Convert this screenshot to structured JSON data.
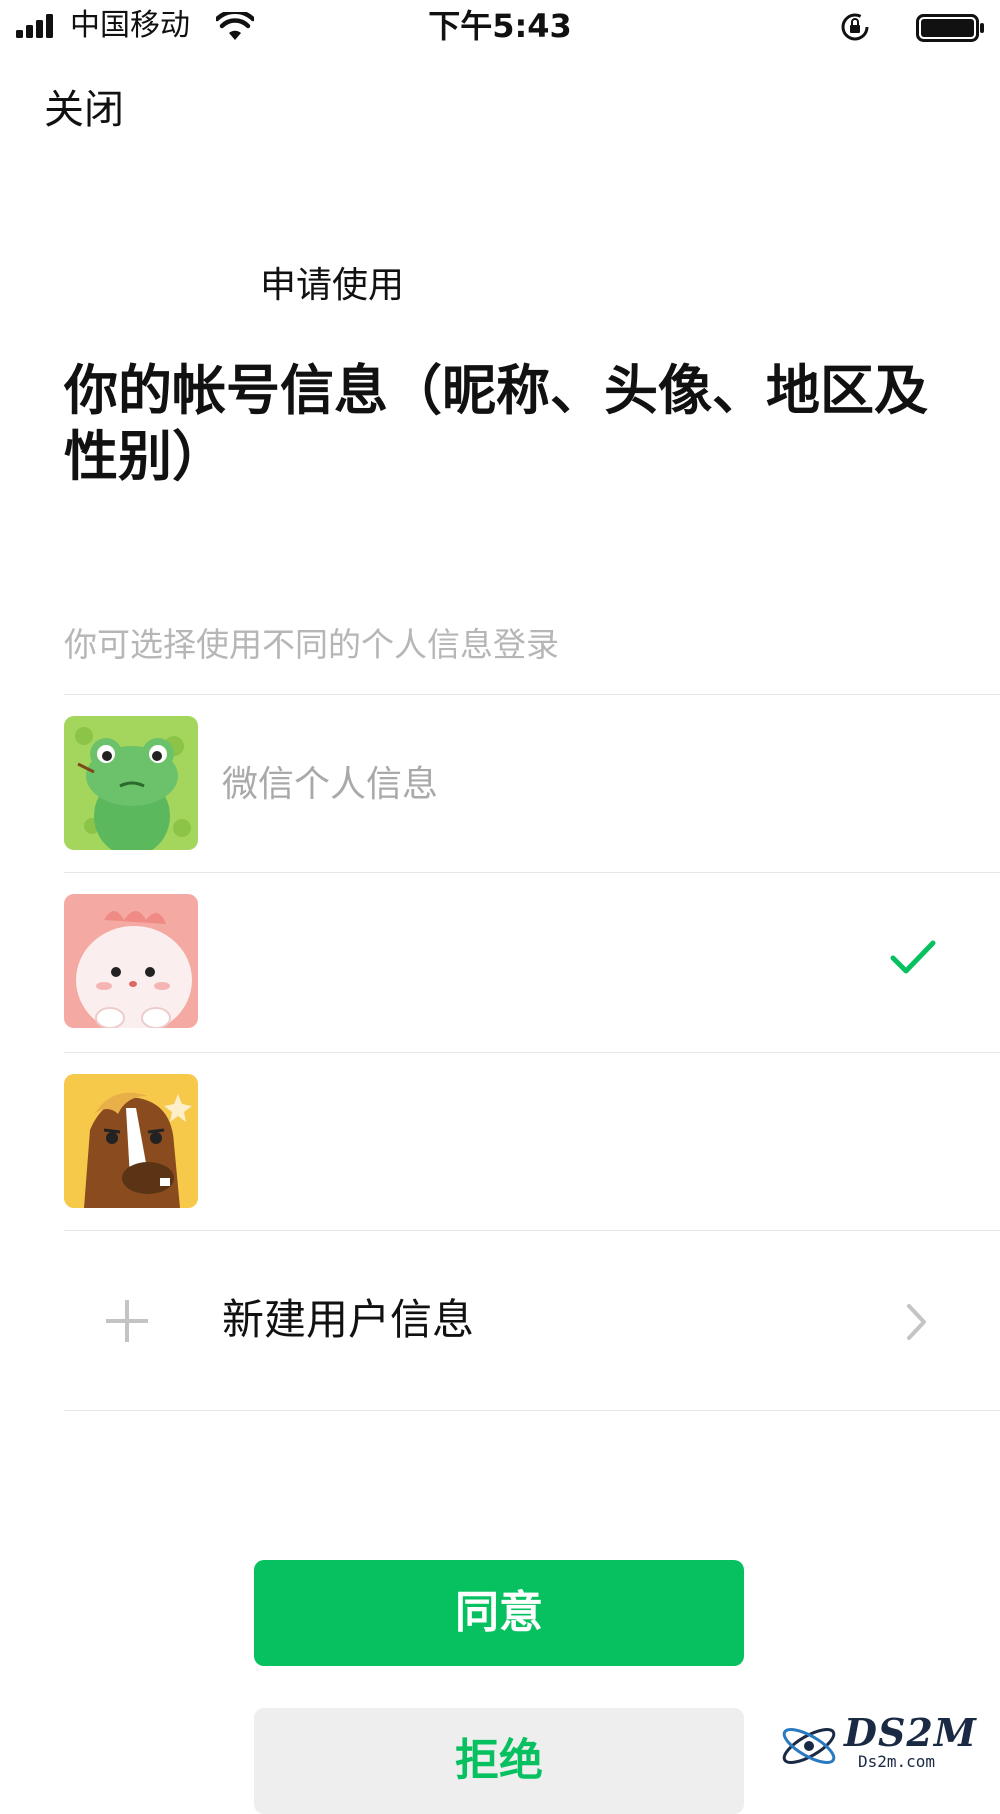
{
  "status_bar": {
    "carrier": "中国移动",
    "time": "下午5:43"
  },
  "nav": {
    "close_label": "关闭"
  },
  "content": {
    "request_label": "申请使用",
    "title": "你的帐号信息（昵称、头像、地区及性别）",
    "hint": "你可选择使用不同的个人信息登录"
  },
  "profiles": [
    {
      "label": "微信个人信息",
      "avatar": "frog-avatar",
      "selected": false
    },
    {
      "label": "",
      "avatar": "pink-creature-avatar",
      "selected": true
    },
    {
      "label": "",
      "avatar": "horse-avatar",
      "selected": false
    }
  ],
  "new_profile": {
    "label": "新建用户信息"
  },
  "buttons": {
    "agree": "同意",
    "reject": "拒绝"
  },
  "watermark": {
    "text": "DS2M",
    "sub": "Ds2m.com"
  },
  "colors": {
    "accent": "#07c160",
    "hint": "#b6b6b6",
    "divider": "#e7e7e7"
  }
}
